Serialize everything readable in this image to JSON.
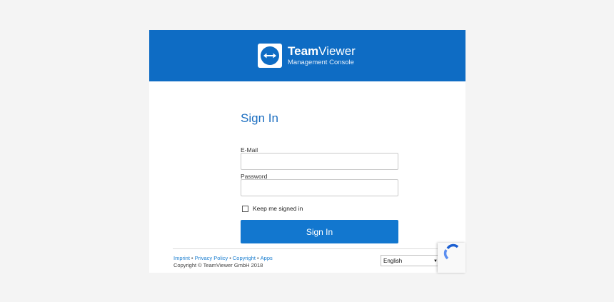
{
  "brand": {
    "name_bold": "Team",
    "name_regular": "Viewer",
    "subtitle": "Management Console",
    "color": "#0e6cc4"
  },
  "form": {
    "title": "Sign In",
    "email_label": "E-Mail",
    "email_value": "",
    "password_label": "Password",
    "password_value": "",
    "keep_signed_in_label": "Keep me signed in",
    "keep_signed_in_checked": false,
    "submit_label": "Sign In",
    "button_color": "#1277cf"
  },
  "footer": {
    "links": [
      "Imprint",
      "Privacy Policy",
      "Copyright",
      "Apps"
    ],
    "separator": "•",
    "copyright": "Copyright © TeamViewer GmbH 2018",
    "language": "English"
  },
  "icons": {
    "logo": "teamviewer-arrows-icon",
    "recaptcha": "recaptcha-icon",
    "dropdown": "chevron-down-icon"
  }
}
